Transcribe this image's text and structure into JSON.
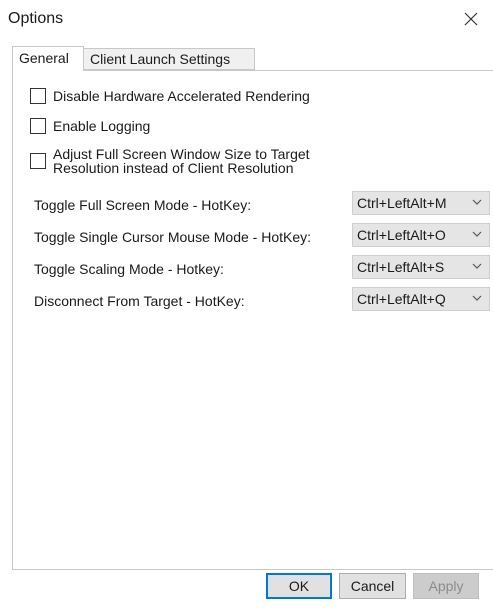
{
  "window": {
    "title": "Options",
    "close_icon": "close-icon"
  },
  "tabs": [
    {
      "label": "General",
      "selected": true
    },
    {
      "label": "Client Launch Settings",
      "selected": false
    }
  ],
  "general": {
    "checkboxes": [
      {
        "label": "Disable Hardware Accelerated Rendering",
        "checked": false
      },
      {
        "label": "Enable Logging",
        "checked": false
      },
      {
        "label_line1": "Adjust Full Screen Window Size to Target",
        "label_line2": "Resolution instead of Client Resolution",
        "checked": false
      }
    ],
    "hotkeys": [
      {
        "label": "Toggle Full Screen Mode - HotKey:",
        "value": "Ctrl+LeftAlt+M"
      },
      {
        "label": "Toggle Single Cursor Mouse Mode - HotKey:",
        "value": "Ctrl+LeftAlt+O"
      },
      {
        "label": "Toggle Scaling Mode - Hotkey:",
        "value": "Ctrl+LeftAlt+S"
      },
      {
        "label": "Disconnect From Target - HotKey:",
        "value": "Ctrl+LeftAlt+Q"
      }
    ]
  },
  "footer": {
    "ok_label": "OK",
    "cancel_label": "Cancel",
    "apply_label": "Apply",
    "apply_enabled": false
  },
  "colors": {
    "accent": "#0078d7",
    "tab_border": "#c8c8c8",
    "select_bg": "#e5e5e5",
    "disabled_text": "#8c8c8c"
  }
}
